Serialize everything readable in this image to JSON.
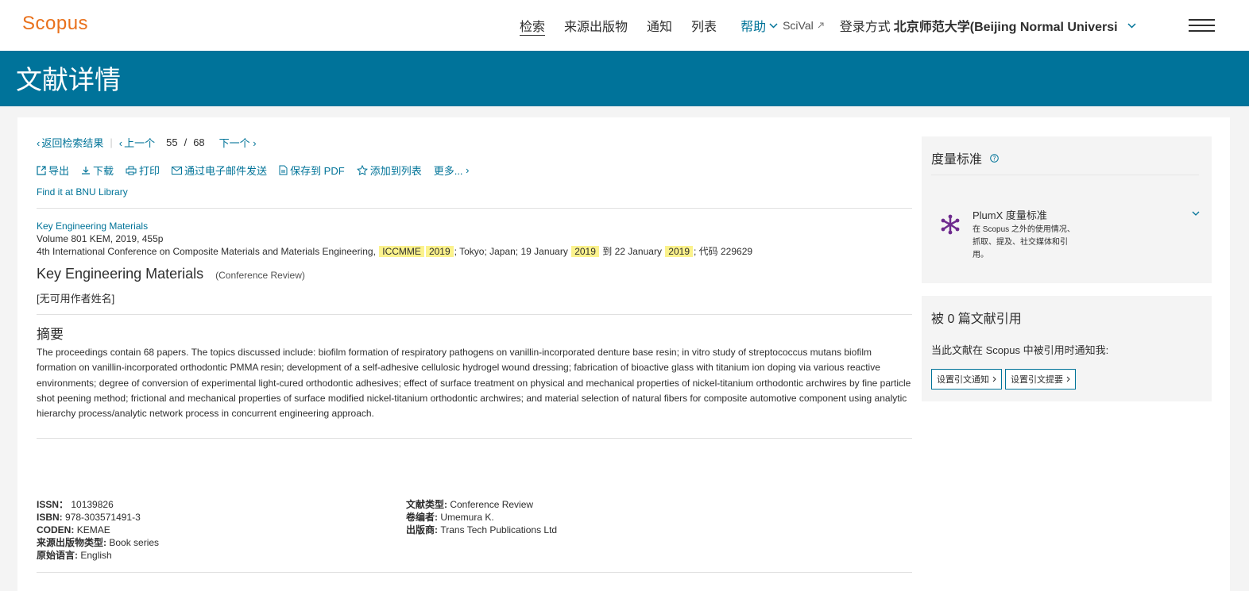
{
  "header": {
    "logo": "Scopus",
    "nav": [
      "检索",
      "来源出版物",
      "通知",
      "列表"
    ],
    "help": "帮助",
    "scival": "SciVal",
    "login_prefix": "登录方式",
    "institution": "北京师范大学(Beijing Normal Universi"
  },
  "banner": {
    "title": "文献详情"
  },
  "doc_nav": {
    "back": "返回检索结果",
    "prev": "上一个",
    "current": "55",
    "slash": "/",
    "total": "68",
    "next": "下一个"
  },
  "actions": {
    "export": "导出",
    "download": "下载",
    "print": "打印",
    "email": "通过电子邮件发送",
    "save_pdf": "保存到 PDF",
    "add_list": "添加到列表",
    "more": "更多..."
  },
  "find_it": "Find it at BNU Library",
  "source": {
    "journal": "Key Engineering Materials",
    "volume_line": "Volume 801 KEM, 2019, 455p",
    "conf_prefix": "4th International Conference on Composite Materials and Materials Engineering,",
    "hl1": "ICCMME",
    "hl2": "2019",
    "mid1": "; Tokyo; Japan; 19 January",
    "hl3": "2019",
    "mid2": "到 22 January",
    "hl4": "2019",
    "suffix": "; 代码 229629"
  },
  "document": {
    "title": "Key Engineering Materials",
    "type": "(Conference Review)",
    "authors": "[无可用作者姓名]"
  },
  "abstract": {
    "heading": "摘要",
    "text": "The proceedings contain 68 papers. The topics discussed include: biofilm formation of respiratory pathogens on vanillin-incorporated denture base resin; in vitro study of streptococcus mutans biofilm formation on vanillin-incorporated orthodontic PMMA resin; development of a self-adhesive cellulosic hydrogel wound dressing; fabrication of bioactive glass with titanium ion doping via various reactive environments; degree of conversion of experimental light-cured orthodontic adhesives; effect of surface treatment on physical and mechanical properties of nickel-titanium orthodontic archwires by fine particle shot peening method; frictional and mechanical properties of surface modified nickel-titanium orthodontic archwires; and material selection of natural fibers for composite automotive component using analytic hierarchy process/analytic network process in concurrent engineering approach."
  },
  "meta_left": [
    {
      "label": "ISSN：",
      "value": "10139826"
    },
    {
      "label": "ISBN:",
      "value": "978-303571491-3"
    },
    {
      "label": "CODEN:",
      "value": "KEMAE"
    },
    {
      "label": "来源出版物类型:",
      "value": "Book series"
    },
    {
      "label": "原始语言:",
      "value": "English"
    }
  ],
  "meta_right": [
    {
      "label": "文献类型:",
      "value": "Conference Review"
    },
    {
      "label": "卷编者:",
      "value": "Umemura K."
    },
    {
      "label": "出版商:",
      "value": "Trans Tech Publications Ltd"
    }
  ],
  "metrics": {
    "heading": "度量标准",
    "plumx_title": "PlumX 度量标准",
    "plumx_desc": "在 Scopus 之外的使用情况、抓取、提及、社交媒体和引用。"
  },
  "citations": {
    "heading": "被 0 篇文献引用",
    "notify_text": "当此文献在 Scopus 中被引用时通知我:",
    "btn_alert": "设置引文通知",
    "btn_feed": "设置引文提要"
  },
  "colors": {
    "brand": "#e9711c",
    "accent": "#007398",
    "banner": "#00739a",
    "highlight": "#fbf28c"
  }
}
